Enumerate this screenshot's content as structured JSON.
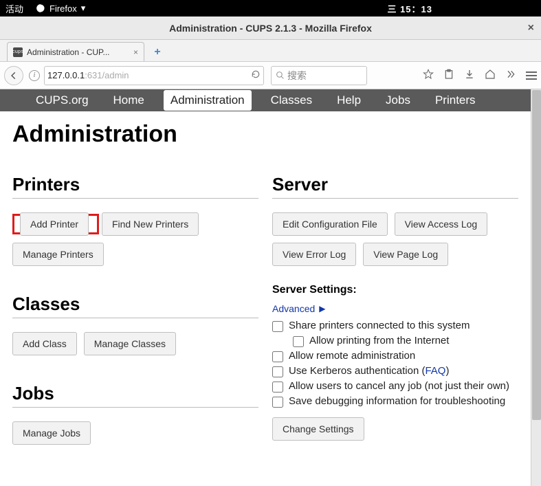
{
  "topbar": {
    "activity": "活动",
    "browser": "Firefox",
    "clock": "三 15：13"
  },
  "window": {
    "title": "Administration - CUPS 2.1.3 - Mozilla Firefox"
  },
  "tab": {
    "title": "Administration - CUP...",
    "favicon": "cups"
  },
  "urlbar": {
    "host": "127.0.0.1",
    "path": ":631/admin"
  },
  "searchbar": {
    "placeholder": "搜索"
  },
  "sitenav": {
    "cups": "CUPS.org",
    "home": "Home",
    "admin": "Administration",
    "classes": "Classes",
    "help": "Help",
    "jobs": "Jobs",
    "printers": "Printers"
  },
  "page": {
    "title": "Administration",
    "printers": {
      "title": "Printers",
      "add": "Add Printer",
      "find": "Find New Printers",
      "manage": "Manage Printers"
    },
    "classes": {
      "title": "Classes",
      "add": "Add Class",
      "manage": "Manage Classes"
    },
    "jobs": {
      "title": "Jobs",
      "manage": "Manage Jobs"
    },
    "server": {
      "title": "Server",
      "editconf": "Edit Configuration File",
      "accesslog": "View Access Log",
      "errorlog": "View Error Log",
      "pagelog": "View Page Log",
      "settings_heading": "Server Settings:",
      "advanced": "Advanced",
      "opt_share": "Share printers connected to this system",
      "opt_internet": "Allow printing from the Internet",
      "opt_remote": "Allow remote administration",
      "opt_kerberos_pre": "Use Kerberos authentication (",
      "opt_kerberos_link": "FAQ",
      "opt_kerberos_post": ")",
      "opt_cancel": "Allow users to cancel any job (not just their own)",
      "opt_debug": "Save debugging information for troubleshooting",
      "change": "Change Settings"
    }
  }
}
